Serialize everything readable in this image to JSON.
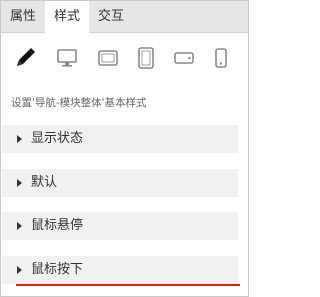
{
  "tabs": [
    {
      "label": "属性"
    },
    {
      "label": "样式",
      "active": true
    },
    {
      "label": "交互"
    }
  ],
  "devices": [
    {
      "icon": "pencil-icon",
      "active": true
    },
    {
      "icon": "desktop-monitor-icon"
    },
    {
      "icon": "tablet-landscape-icon"
    },
    {
      "icon": "tablet-portrait-icon"
    },
    {
      "icon": "phone-landscape-icon"
    },
    {
      "icon": "phone-portrait-icon"
    }
  ],
  "hint": "设置'导航-模块整体'基本样式",
  "sections": [
    {
      "label": "显示状态"
    },
    {
      "label": "默认"
    },
    {
      "label": "鼠标悬停"
    },
    {
      "label": "鼠标按下"
    }
  ],
  "colors": {
    "tab_bar": "#e6e6e6",
    "section_bg": "#f1f1f1",
    "icon_gray": "#8a8a8a",
    "highlight_line": "#e2231a"
  }
}
